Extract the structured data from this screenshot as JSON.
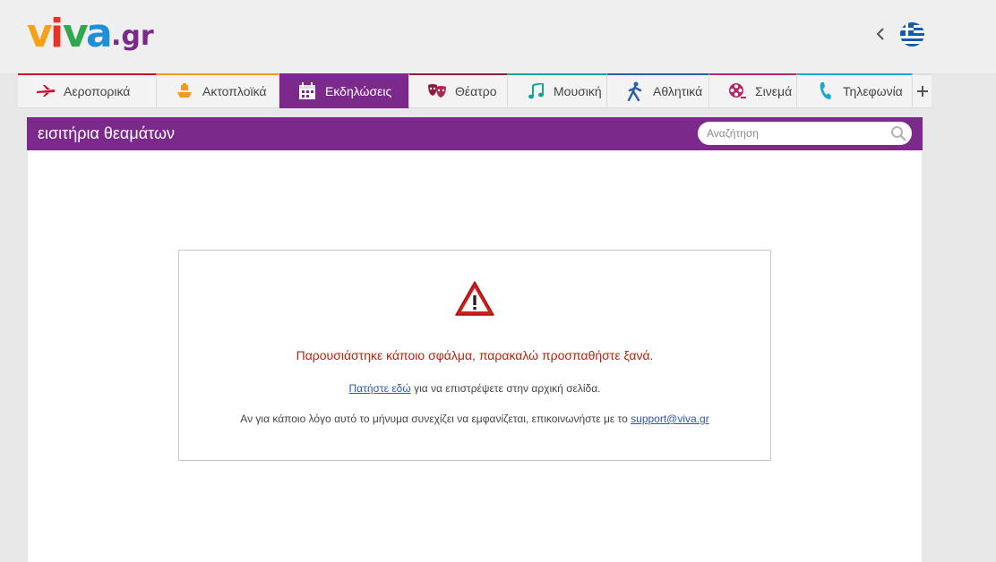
{
  "header": {
    "logo_text": "viva.gr",
    "language": "Ελληνικά"
  },
  "nav": {
    "tabs": [
      {
        "label": "Αεροπορικά",
        "icon": "airplane-icon",
        "color": "#c8102e"
      },
      {
        "label": "Ακτοπλοϊκά",
        "icon": "ferry-icon",
        "color": "#f29a1f"
      },
      {
        "label": "Εκδηλώσεις",
        "icon": "calendar-icon",
        "color": "#7b2a8c",
        "active": true
      },
      {
        "label": "Θέατρο",
        "icon": "theater-masks-icon",
        "color": "#8a1c3f"
      },
      {
        "label": "Μουσική",
        "icon": "music-note-icon",
        "color": "#18a39a"
      },
      {
        "label": "Αθλητικά",
        "icon": "runner-icon",
        "color": "#2b5da6"
      },
      {
        "label": "Σινεμά",
        "icon": "film-reel-icon",
        "color": "#b02a6b"
      },
      {
        "label": "Τηλεφωνία",
        "icon": "phone-icon",
        "color": "#1aa7d6"
      }
    ]
  },
  "section": {
    "title": "εισιτήρια θεαμάτων",
    "search_placeholder": "Αναζήτηση"
  },
  "error": {
    "message": "Παρουσιάστηκε κάποιο σφάλμα, παρακαλώ προσπαθήστε ξανά.",
    "back_link": "Πατήστε εδώ",
    "back_text": " για να επιστρέψετε στην αρχική σελίδα.",
    "contact_text": "Αν για κάποιο λόγο αυτό το μήνυμα συνεχίζει να εμφανίζεται, επικοινωνήστε με το ",
    "contact_email": "support@viva.gr"
  },
  "colors": {
    "brand_purple": "#7b2a8c",
    "error_red": "#b2260c",
    "link_blue": "#2d5aa7"
  }
}
